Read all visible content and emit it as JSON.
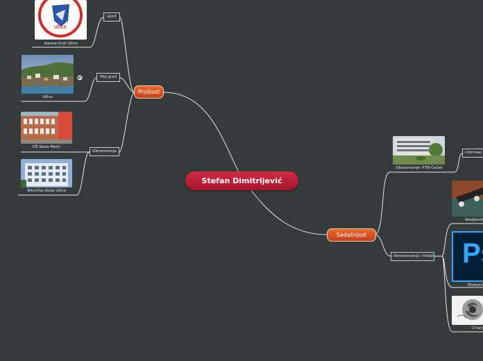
{
  "central": {
    "label": "Stefan Dimitrijević"
  },
  "branches": {
    "past": {
      "label": "Prošlost"
    },
    "present": {
      "label": "Sadašnjost"
    }
  },
  "topics": {
    "sport": "sport",
    "city": "Moj grad",
    "education": "Obrazovanje",
    "info": "Informac",
    "interests": "Itenresovanja i hobiji"
  },
  "images": {
    "karate": "Karate klub Užice",
    "uzice": "Užice",
    "os": "OŠ Nada Matić",
    "tech": "Tehnička škola Užice",
    "ftn": "Obrazovanje- FTN Čačak",
    "skate": "Skejtbord",
    "photoshop": "Photosh",
    "drawing": "Crtanj",
    "ps_logo": "Ps"
  },
  "colors": {
    "background": "#353b3b",
    "central": "#c41f3a",
    "branch": "#d9552a",
    "line": "#e6e9e9"
  }
}
